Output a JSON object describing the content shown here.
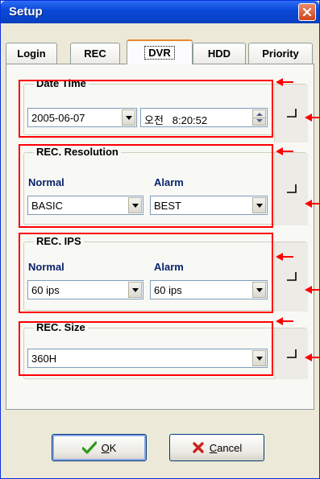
{
  "window": {
    "title": "Setup"
  },
  "tabs": [
    {
      "label": "Login"
    },
    {
      "label": "REC"
    },
    {
      "label": "DVR"
    },
    {
      "label": "HDD"
    },
    {
      "label": "Priority"
    }
  ],
  "active_tab": "DVR",
  "date_time": {
    "title": "Date Time",
    "date_value": "2005-06-07",
    "time_value": "오전   8:20:52"
  },
  "rec_resolution": {
    "title": "REC. Resolution",
    "normal_label": "Normal",
    "alarm_label": "Alarm",
    "normal_value": "BASIC",
    "alarm_value": "BEST"
  },
  "rec_ips": {
    "title": "REC. IPS",
    "normal_label": "Normal",
    "alarm_label": "Alarm",
    "normal_value": "60 ips",
    "alarm_value": "60 ips"
  },
  "rec_size": {
    "title": "REC. Size",
    "value": "360H"
  },
  "buttons": {
    "ok_access": "O",
    "ok_rest": "K",
    "cancel_access": "C",
    "cancel_rest": "ancel"
  },
  "colors": {
    "annotation": "#ff0000",
    "title_bar": "#0a4ad8",
    "label_blue": "#0a246a"
  },
  "icons": {
    "ok": "check-icon",
    "cancel": "x-mark-icon",
    "apply": "enter-return-icon",
    "close": "close-icon"
  }
}
